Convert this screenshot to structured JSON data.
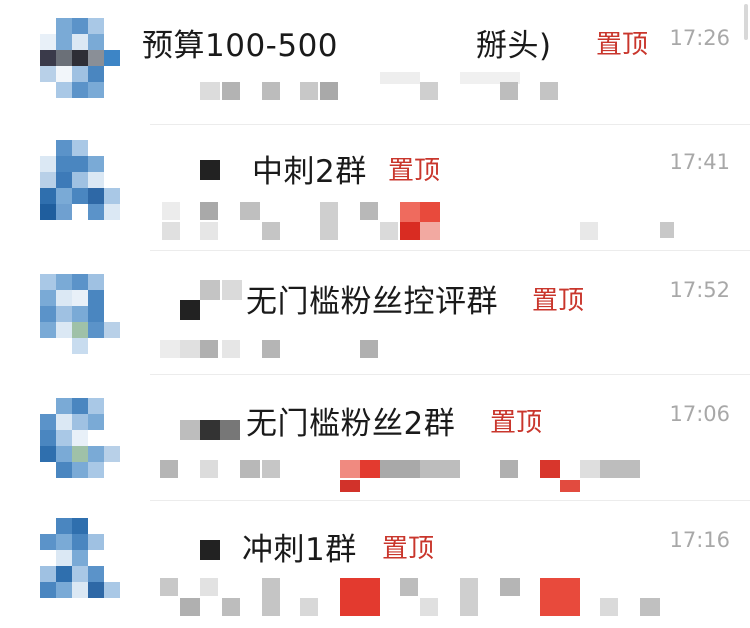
{
  "chats": [
    {
      "title": "预算100-500",
      "title_suffix": "掰头)",
      "pin": "置顶",
      "time": "17:26"
    },
    {
      "title": "中刺2群",
      "pin": "置顶",
      "time": "17:41"
    },
    {
      "title": "无门槛粉丝控评群",
      "pin": "置顶",
      "time": "17:52"
    },
    {
      "title": "无门槛粉丝2群",
      "pin": "置顶",
      "time": "17:06"
    },
    {
      "title": "冲刺1群",
      "pin": "置顶",
      "time": "17:16"
    }
  ],
  "colors": {
    "pin": "#c9362c",
    "time": "#a8a8a8",
    "avatar_blue": "#4a86c0",
    "mosaic_red": "#e33a2f"
  }
}
